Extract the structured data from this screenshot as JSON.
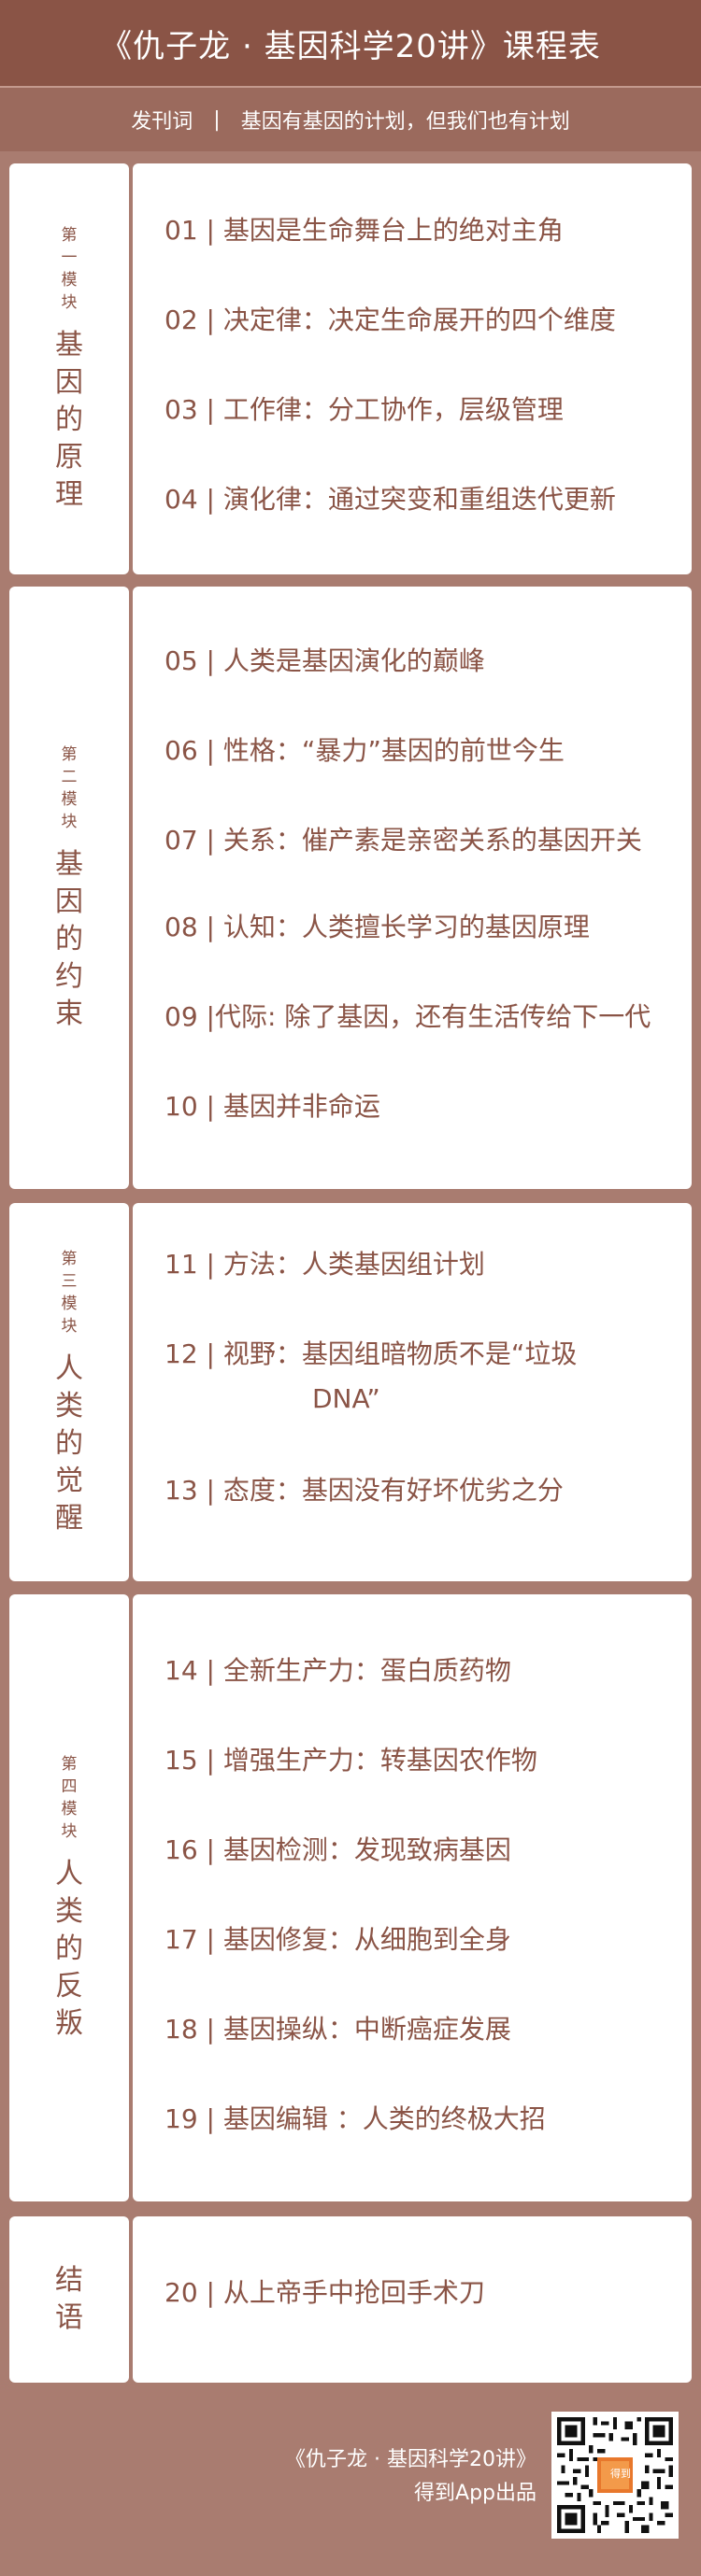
{
  "header": {
    "title": "《仇子龙 · 基因科学20讲》课程表"
  },
  "preface": {
    "label": "发刊词",
    "separator": "|",
    "title": "基因有基因的计划，但我们也有计划"
  },
  "modules": [
    {
      "small": [
        "第",
        "一",
        "模",
        "块"
      ],
      "big": [
        "基",
        "因",
        "的",
        "原",
        "理"
      ],
      "items": [
        "01 | 基因是生命舞台上的绝对主角",
        "02 | 决定律：决定生命展开的四个维度",
        "03 | 工作律：分工协作，层级管理",
        "04 | 演化律：通过突变和重组迭代更新"
      ]
    },
    {
      "small": [
        "第",
        "二",
        "模",
        "块"
      ],
      "big": [
        "基",
        "因",
        "的",
        "约",
        "束"
      ],
      "items": [
        "05 | 人类是基因演化的巅峰",
        "06 | 性格：“暴力”基因的前世今生",
        "07 | 关系：催产素是亲密关系的基因开关",
        "08 | 认知：人类擅长学习的基因原理",
        "09 |代际: 除了基因，还有生活传给下一代",
        "10 | 基因并非命运"
      ]
    },
    {
      "small": [
        "第",
        "三",
        "模",
        "块"
      ],
      "big": [
        "人",
        "类",
        "的",
        "觉",
        "醒"
      ],
      "items": [
        "11 | 方法：人类基因组计划",
        "12 | 视野：基因组暗物质不是“垃圾",
        "DNA”",
        "13 | 态度：基因没有好坏优劣之分"
      ]
    },
    {
      "small": [
        "第",
        "四",
        "模",
        "块"
      ],
      "big": [
        "人",
        "类",
        "的",
        "反",
        "叛"
      ],
      "items": [
        "14 | 全新生产力：蛋白质药物",
        "15 | 增强生产力：转基因农作物",
        "16 | 基因检测：发现致病基因",
        "17 | 基因修复：从细胞到全身",
        "18 | 基因操纵：中断癌症发展",
        "19 | 基因编辑 ：人类的终极大招"
      ]
    },
    {
      "small": [],
      "big": [
        "结",
        "语"
      ],
      "items": [
        "20 | 从上帝手中抢回手术刀"
      ]
    }
  ],
  "footer": {
    "course": "《仇子龙 · 基因科学20讲》",
    "publisher": "得到App出品",
    "qr_badge": "得到"
  },
  "colors": {
    "header": "#8a5446",
    "background": "#a97c70",
    "text": "#8a5446",
    "card": "#ffffff"
  }
}
